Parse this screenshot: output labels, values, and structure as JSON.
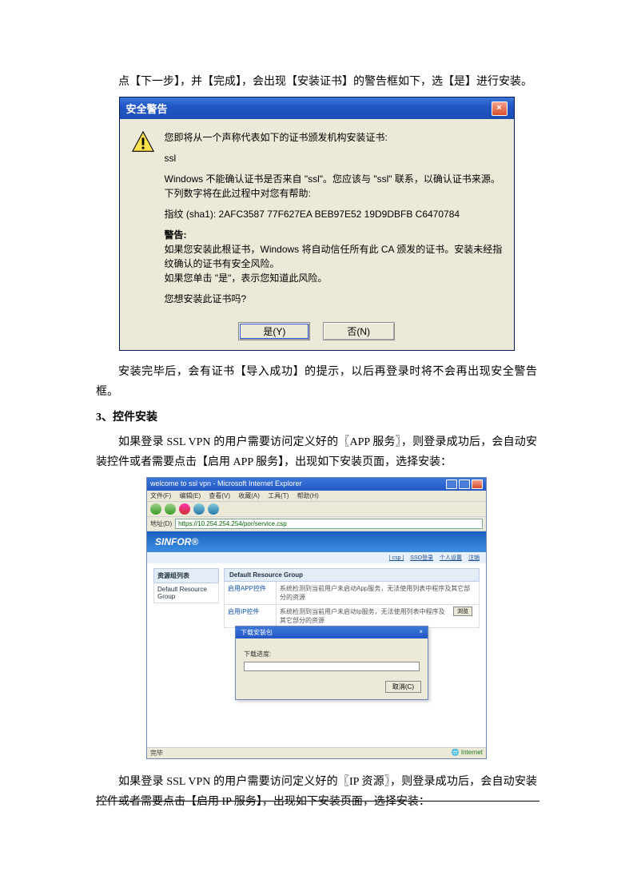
{
  "para1": "点【下一步】，并【完成】，会出现【安装证书】的警告框如下，选【是】进行安装。",
  "para2": "安装完毕后，会有证书【导入成功】的提示，以后再登录时将不会再出现安全警告框。",
  "heading3": "3、控件安装",
  "para3a": "如果登录 SSL  VPN 的用户需要访问定义好的〖APP 服务〗，则登录成功后，会自动安装控件或者需要点击【启用 APP 服务】，出现如下安装页面，选择安装：",
  "para3b": "如果登录 SSL  VPN 的用户需要访问定义好的〖IP 资源〗，则登录成功后，会自动安装控件或者需要点击【启用 IP 服务】，出现如下安装页面，选择安装：",
  "xp": {
    "title": "安全警告",
    "close": "×",
    "line1": "您即将从一个声称代表如下的证书颁发机构安装证书:",
    "line2": "ssl",
    "line3": "Windows 不能确认证书是否来自 \"ssl\"。您应该与 \"ssl\" 联系，以确认证书来源。 下列数字将在此过程中对您有帮助:",
    "line4": "指纹 (sha1): 2AFC3587 77F627EA BEB97E52 19D9DBFB C6470784",
    "line5_label": "警告:",
    "line5a": "如果您安装此根证书，Windows 将自动信任所有此 CA 颁发的证书。安装未经指纹确认的证书有安全风险。",
    "line5b": "如果您单击 \"是\"，表示您知道此风险。",
    "line6": "您想安装此证书吗?",
    "btn_yes": "是(Y)",
    "btn_no": "否(N)"
  },
  "ie": {
    "title": "welcome to ssl vpn - Microsoft Internet Explorer",
    "menu": {
      "file": "文件(F)",
      "edit": "编辑(E)",
      "view": "查看(V)",
      "fav": "收藏(A)",
      "tools": "工具(T)",
      "help": "帮助(H)"
    },
    "addr_label": "地址(D)",
    "addr_url": "https://10.254.254.254/por/service.csp",
    "links": {
      "csp": "| csp |",
      "sso": "SSO登录",
      "personal": "个人设置",
      "logout": "注销"
    },
    "brand": "SINFOR®",
    "side_head": "资源组列表",
    "side_item": "Default Resource Group",
    "main_head": "Default Resource Group",
    "row1_c1": "启用APP控件",
    "row1_c2": "系统检测到当前用户未启动App服务，无法使用列表中程序及其它部分的资源",
    "row2_c1": "启用IP控件",
    "row2_c2": "系统检测到当前用户未启动Ip服务，无法使用列表中程序及其它部分的资源",
    "browse_btn": "浏览",
    "dl_title": "下载安装包",
    "dl_label": "下载进度:",
    "dl_btn": "取消(C)",
    "status_left": "完毕",
    "status_right": "Internet"
  }
}
